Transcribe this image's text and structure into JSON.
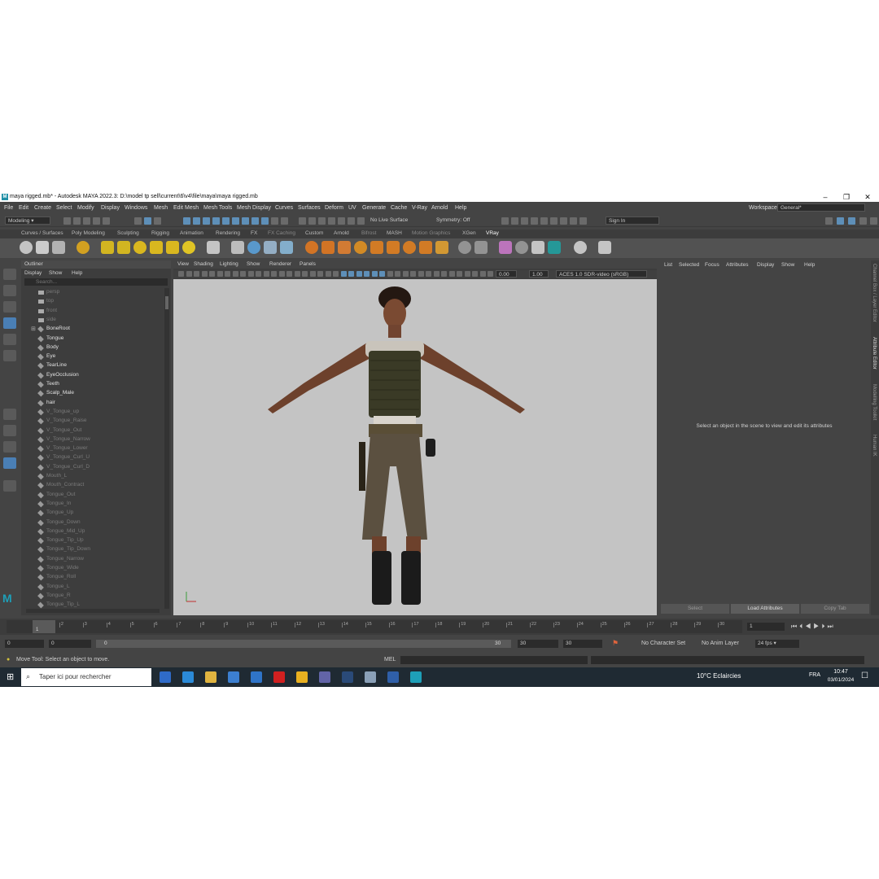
{
  "window": {
    "title": "maya rigged.mb* - Autodesk MAYA 2022.3: D:\\model tp sell\\current\\6\\v4\\file\\maya\\maya rigged.mb",
    "logo": "M"
  },
  "menubar": {
    "items": [
      "File",
      "Edit",
      "Create",
      "Select",
      "Modify",
      "Display",
      "Windows",
      "Mesh",
      "Edit Mesh",
      "Mesh Tools",
      "Mesh Display",
      "Curves",
      "Surfaces",
      "Deform",
      "UV",
      "Generate",
      "Cache",
      "V-Ray",
      "Arnold",
      "Help"
    ],
    "workspace_label": "Workspace:",
    "workspace_value": "General*"
  },
  "statusline": {
    "menuset": "Modeling",
    "live_surface": "No Live Surface",
    "symmetry": "Symmetry: Off",
    "sign_in": "Sign In"
  },
  "shelf": {
    "tabs": [
      "Curves / Surfaces",
      "Poly Modeling",
      "Sculpting",
      "Rigging",
      "Animation",
      "Rendering",
      "FX",
      "FX Caching",
      "Custom",
      "Arnold",
      "Bifrost",
      "MASH",
      "Motion Graphics",
      "XGen",
      "VRay"
    ],
    "active_tab": "VRay"
  },
  "outliner": {
    "title": "Outliner",
    "menu": [
      "Display",
      "Show",
      "Help"
    ],
    "search_placeholder": "Search...",
    "items": [
      {
        "label": "persp",
        "dim": true,
        "kind": "camera"
      },
      {
        "label": "top",
        "dim": true,
        "kind": "camera"
      },
      {
        "label": "front",
        "dim": true,
        "kind": "camera"
      },
      {
        "label": "side",
        "dim": true,
        "kind": "camera"
      },
      {
        "label": "BoneRoot",
        "dim": false,
        "kind": "joint"
      },
      {
        "label": "Tongue",
        "dim": false,
        "kind": "mesh"
      },
      {
        "label": "Body",
        "dim": false,
        "kind": "mesh"
      },
      {
        "label": "Eye",
        "dim": false,
        "kind": "mesh"
      },
      {
        "label": "TearLine",
        "dim": false,
        "kind": "mesh"
      },
      {
        "label": "EyeOcclusion",
        "dim": false,
        "kind": "mesh"
      },
      {
        "label": "Teeth",
        "dim": false,
        "kind": "mesh"
      },
      {
        "label": "Scalp_Male",
        "dim": false,
        "kind": "mesh"
      },
      {
        "label": "hair",
        "dim": false,
        "kind": "mesh"
      },
      {
        "label": "V_Tongue_up",
        "dim": true,
        "kind": "mesh"
      },
      {
        "label": "V_Tongue_Raise",
        "dim": true,
        "kind": "mesh"
      },
      {
        "label": "V_Tongue_Out",
        "dim": true,
        "kind": "mesh"
      },
      {
        "label": "V_Tongue_Narrow",
        "dim": true,
        "kind": "mesh"
      },
      {
        "label": "V_Tongue_Lower",
        "dim": true,
        "kind": "mesh"
      },
      {
        "label": "V_Tongue_Curl_U",
        "dim": true,
        "kind": "mesh"
      },
      {
        "label": "V_Tongue_Curl_D",
        "dim": true,
        "kind": "mesh"
      },
      {
        "label": "Mouth_L",
        "dim": true,
        "kind": "mesh"
      },
      {
        "label": "Mouth_Contract",
        "dim": true,
        "kind": "mesh"
      },
      {
        "label": "Tongue_Out",
        "dim": true,
        "kind": "mesh"
      },
      {
        "label": "Tongue_In",
        "dim": true,
        "kind": "mesh"
      },
      {
        "label": "Tongue_Up",
        "dim": true,
        "kind": "mesh"
      },
      {
        "label": "Tongue_Down",
        "dim": true,
        "kind": "mesh"
      },
      {
        "label": "Tongue_Mid_Up",
        "dim": true,
        "kind": "mesh"
      },
      {
        "label": "Tongue_Tip_Up",
        "dim": true,
        "kind": "mesh"
      },
      {
        "label": "Tongue_Tip_Down",
        "dim": true,
        "kind": "mesh"
      },
      {
        "label": "Tongue_Narrow",
        "dim": true,
        "kind": "mesh"
      },
      {
        "label": "Tongue_Wide",
        "dim": true,
        "kind": "mesh"
      },
      {
        "label": "Tongue_Roll",
        "dim": true,
        "kind": "mesh"
      },
      {
        "label": "Tongue_L",
        "dim": true,
        "kind": "mesh"
      },
      {
        "label": "Tongue_R",
        "dim": true,
        "kind": "mesh"
      },
      {
        "label": "Tongue_Tip_L",
        "dim": true,
        "kind": "mesh"
      }
    ]
  },
  "viewport": {
    "menu": [
      "View",
      "Shading",
      "Lighting",
      "Show",
      "Renderer",
      "Panels"
    ],
    "exposure": "0.00",
    "gamma": "1.00",
    "color_space": "ACES 1.0 SDR-video (sRGB)"
  },
  "attribute_editor": {
    "menu": [
      "List",
      "Selected",
      "Focus",
      "Attributes",
      "Display",
      "Show",
      "Help"
    ],
    "message": "Select an object in the scene to view and edit its attributes",
    "buttons": [
      "Select",
      "Load Attributes",
      "Copy Tab"
    ]
  },
  "side_tabs": [
    "Channel Box / Layer Editor",
    "Attribute Editor",
    "Modelling Toolkit",
    "Human IK"
  ],
  "timeline": {
    "ticks": [
      "1",
      "2",
      "3",
      "4",
      "5",
      "6",
      "7",
      "8",
      "9",
      "10",
      "11",
      "12",
      "13",
      "14",
      "15",
      "16",
      "17",
      "18",
      "19",
      "20",
      "21",
      "22",
      "23",
      "24",
      "25",
      "26",
      "27",
      "28",
      "29",
      "30"
    ],
    "current_frame": "1",
    "current_frame_marker": "1"
  },
  "range": {
    "start": "0",
    "anim_start": "0",
    "slider_start": "0",
    "slider_end": "30",
    "end": "30",
    "anim_end": "30",
    "character_set": "No Character Set",
    "anim_layer": "No Anim Layer",
    "fps": "24 fps"
  },
  "helpline": {
    "message": "Move Tool: Select an object to move.",
    "mel_label": "MEL"
  },
  "taskbar": {
    "search_placeholder": "Taper ici pour rechercher",
    "weather": "10°C  Eclaircies",
    "lang": "FRA",
    "time": "10:47",
    "date": "03/01/2024"
  }
}
